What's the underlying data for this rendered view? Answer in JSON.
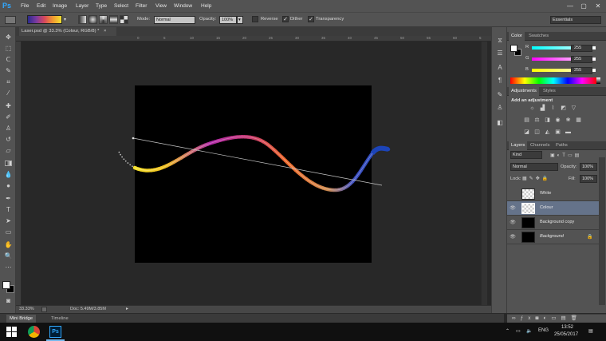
{
  "app": {
    "logo": "Ps",
    "document_tab": "Laser.psd @ 33.3% (Colour, RGB/8) *",
    "tab_close": "×"
  },
  "menu": [
    "File",
    "Edit",
    "Image",
    "Layer",
    "Type",
    "Select",
    "Filter",
    "View",
    "Window",
    "Help"
  ],
  "window_controls": {
    "minimize": "—",
    "maximize": "▢",
    "close": "✕"
  },
  "options": {
    "mode_label": "Mode:",
    "mode_value": "Normal",
    "opacity_label": "Opacity:",
    "opacity_value": "100%",
    "reverse_label": "Reverse",
    "dither_label": "Dither",
    "transparency_label": "Transparency",
    "reverse_checked": false,
    "dither_checked": true,
    "transparency_checked": true,
    "workspace": "Essentials"
  },
  "rulers": {
    "top": [
      "0",
      "5",
      "10",
      "15",
      "20",
      "25",
      "30",
      "35",
      "40",
      "45",
      "50",
      "55",
      "60",
      "5"
    ]
  },
  "status": {
    "zoom": "33.33%",
    "doc": "Doc: 5.49M/3.85M"
  },
  "bottom_tabs": [
    "Mini Bridge",
    "Timeline"
  ],
  "color_panel": {
    "tabs": [
      "Color",
      "Swatches"
    ],
    "channels": [
      {
        "label": "R",
        "value": "255"
      },
      {
        "label": "G",
        "value": "255"
      },
      {
        "label": "B",
        "value": "255"
      }
    ],
    "fg_color": "#ffffff",
    "bg_color": "#000000"
  },
  "adjustments_panel": {
    "tabs": [
      "Adjustments",
      "Styles"
    ],
    "title": "Add an adjustment"
  },
  "layers_panel": {
    "tabs": [
      "Layers",
      "Channels",
      "Paths"
    ],
    "filter": "Kind",
    "blend_mode": "Normal",
    "opacity_label": "Opacity:",
    "opacity_value": "100%",
    "lock_label": "Lock:",
    "fill_label": "Fill:",
    "fill_value": "100%",
    "layers": [
      {
        "name": "White",
        "visible": false,
        "selected": false,
        "thumb": "checker"
      },
      {
        "name": "Colour",
        "visible": true,
        "selected": true,
        "thumb": "checker"
      },
      {
        "name": "Background copy",
        "visible": true,
        "selected": false,
        "thumb": "black"
      },
      {
        "name": "Background",
        "visible": true,
        "selected": false,
        "thumb": "black",
        "locked": true
      }
    ]
  },
  "taskbar": {
    "time": "13:52",
    "date": "25/05/2017",
    "lang": "ENG"
  }
}
